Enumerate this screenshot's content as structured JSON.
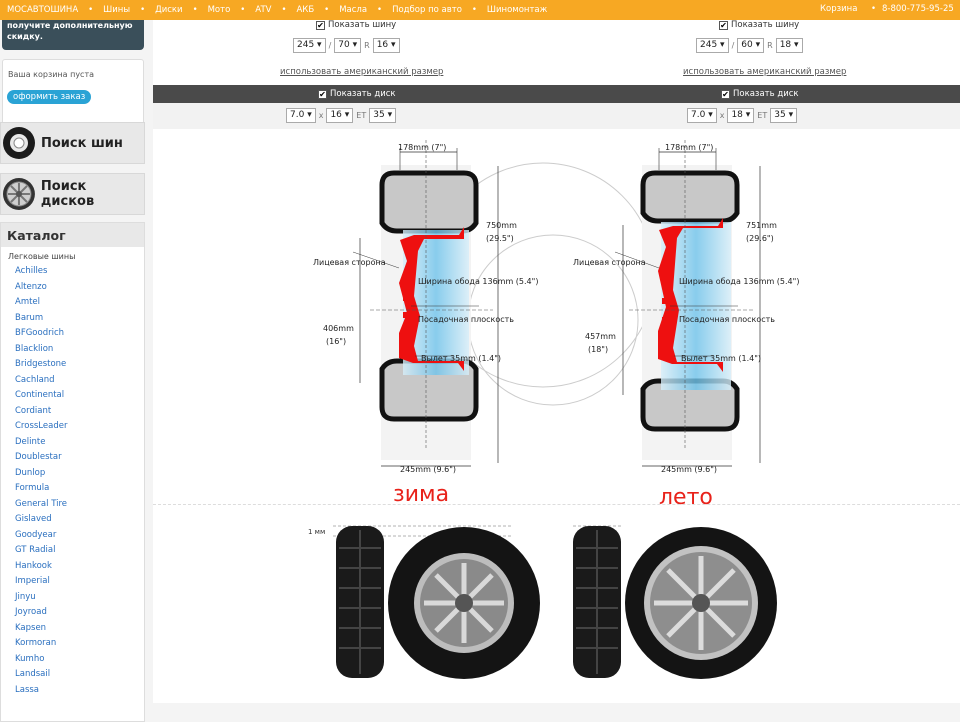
{
  "topbar": {
    "brand": "МОСАВТОШИНА",
    "nav": [
      "Шины",
      "Диски",
      "Мото",
      "ATV",
      "АКБ",
      "Масла",
      "Подбор по авто",
      "Шиномонтаж"
    ],
    "cart": "Корзина",
    "phone": "8-800-775-95-25"
  },
  "sidebar": {
    "promo_line1": "получите дополнительную",
    "promo_line2": "скидку.",
    "cart_empty": "Ваша корзина пуста",
    "order_button": "оформить заказ",
    "tire_search": "Поиск шин",
    "disk_search": "Поиск дисков",
    "catalog_title": "Каталог",
    "catalog_sub": "Легковые шины",
    "brands": [
      "Achilles",
      "Altenzo",
      "Amtel",
      "Barum",
      "BFGoodrich",
      "Blacklion",
      "Bridgestone",
      "Cachland",
      "Continental",
      "Cordiant",
      "CrossLeader",
      "Delinte",
      "Doublestar",
      "Dunlop",
      "Formula",
      "General Tire",
      "Gislaved",
      "Goodyear",
      "GT Radial",
      "Hankook",
      "Imperial",
      "Jinyu",
      "Joyroad",
      "Kapsen",
      "Kormoran",
      "Kumho",
      "Landsail",
      "Lassa"
    ]
  },
  "compare": {
    "show_tire": "Показать шину",
    "show_disk": "Показать диск",
    "american": "использовать американский размер",
    "left": {
      "width": "245",
      "profile": "70",
      "r": "R",
      "diameter": "16",
      "rim_w": "7.0",
      "x": "x",
      "rim_d": "16",
      "et": "ET",
      "et_val": "35",
      "dim_top": "178mm (7\")",
      "dim_height": "750mm",
      "dim_height2": "(29.5\")",
      "dim_rim": "406mm",
      "dim_rim2": "(16\")",
      "dim_bottom": "245mm (9.6\")",
      "face": "Лицевая сторона",
      "rim_width": "Ширина обода 136mm (5.4\")",
      "mount": "Посадочная плоскость",
      "offset": "Вылет 35mm (1.4\")",
      "season": "зима"
    },
    "right": {
      "width": "245",
      "profile": "60",
      "r": "R",
      "diameter": "18",
      "rim_w": "7.0",
      "x": "x",
      "rim_d": "18",
      "et": "ET",
      "et_val": "35",
      "dim_top": "178mm (7\")",
      "dim_height": "751mm",
      "dim_height2": "(29.6\")",
      "dim_rim": "457mm",
      "dim_rim2": "(18\")",
      "dim_bottom": "245mm (9.6\")",
      "face": "Лицевая сторона",
      "rim_width": "Ширина обода 136mm (5.4\")",
      "mount": "Посадочная плоскость",
      "offset": "Вылет 35mm (1.4\")",
      "season": "лето"
    },
    "diff": "1 мм"
  },
  "colors": {
    "topbar": "#f7a823",
    "accent_red": "#e8221a",
    "link": "#2a6fbf",
    "rim_blue": "#bfe4f5"
  }
}
